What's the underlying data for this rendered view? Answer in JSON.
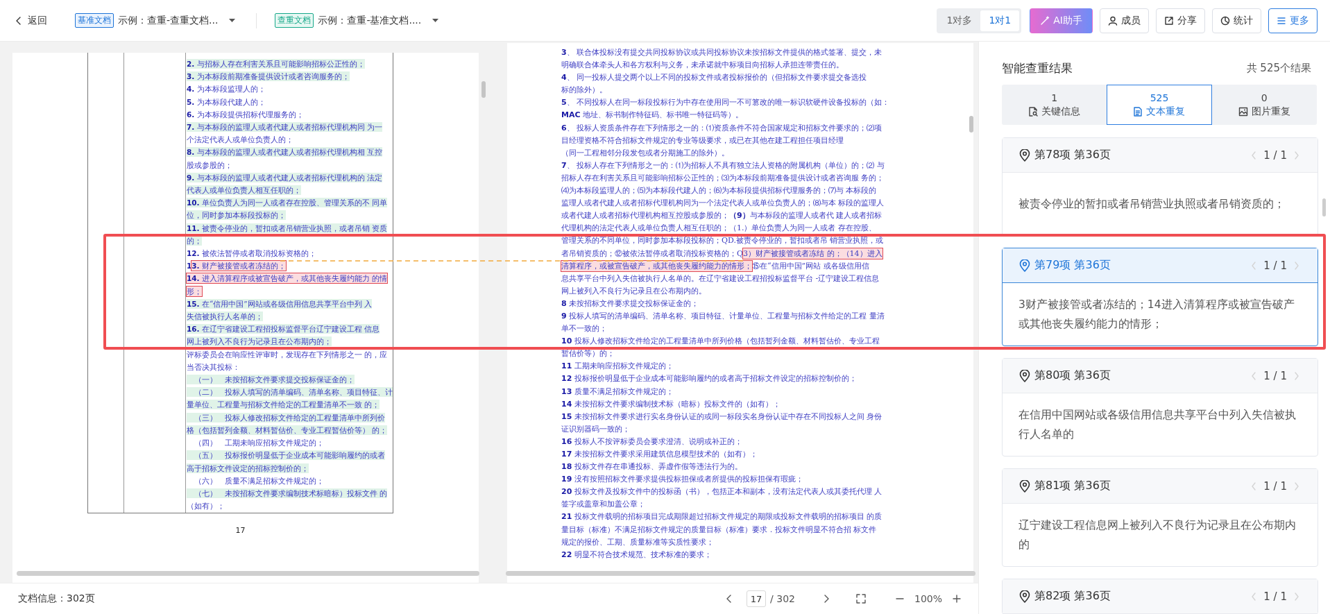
{
  "toolbar": {
    "back": "返回",
    "documents": [
      {
        "kind": "base",
        "tag": "基准文档",
        "name": "示例：查重-查重文档..."
      },
      {
        "kind": "check",
        "tag": "查重文档",
        "name": "示例：查重-基准文档...."
      }
    ],
    "view_modes": [
      {
        "label": "1对多",
        "selected": false
      },
      {
        "label": "1对1",
        "selected": true
      }
    ],
    "actions": [
      {
        "kind": "ai",
        "label": "AI助手"
      },
      {
        "kind": "members",
        "label": "成员"
      },
      {
        "kind": "share",
        "label": "分享"
      },
      {
        "kind": "stats",
        "label": "统计"
      },
      {
        "kind": "more",
        "label": "更多"
      }
    ]
  },
  "left_document": {
    "page_number": "17",
    "lines": [
      [
        {
          "text": "**2.** 与招标人存在利害关系且可能影响招标公正性的；",
          "kind": "similar"
        }
      ],
      [
        {
          "text": "**3.** 为本标段前期准备提供设计或者咨询服务的；",
          "kind": "similar"
        }
      ],
      [
        {
          "text": "**4.** 为本标段监理人的；",
          "kind": "plain"
        }
      ],
      [
        {
          "text": "**5.** 为本标段代建人的；",
          "kind": "plain"
        }
      ],
      [
        {
          "text": "**6.** 为本标段提供招标代理服务的；",
          "kind": "plain"
        }
      ],
      [
        {
          "text": "**7.** 与本标段的监理人或者代建人或者招标代理机构同 为一",
          "kind": "similar"
        }
      ],
      [
        {
          "text": "个法定代表人或单位负责人的；",
          "kind": "plain"
        }
      ],
      [
        {
          "text": "**8.** 与本标段的监理人或者代建人或者招标代理机构相 互控",
          "kind": "similar"
        }
      ],
      [
        {
          "text": "股或参股的；",
          "kind": "plain"
        }
      ],
      [
        {
          "text": "**9.** 与本标段的监理人或者代建人或者招标代理机构的 法定",
          "kind": "similar"
        }
      ],
      [
        {
          "text": "代表人或单位负责人相互任职的；",
          "kind": "similar"
        }
      ],
      [
        {
          "text": "**10.** 单位负责人为同一人或者存在控股、管理关系的不 同单",
          "kind": "similar"
        }
      ],
      [
        {
          "text": "位，同时参加本标段投标的；",
          "kind": "similar"
        }
      ],
      [
        {
          "text": "**11.** 被责令停业的，暂扣或者吊销营业执照，或者吊销 资质",
          "kind": "similar"
        }
      ],
      [
        {
          "text": "的；",
          "kind": "similar"
        }
      ],
      [
        {
          "text": "**12.** 被依法暂停或者取消投标资格的；",
          "kind": "plain"
        }
      ],
      [
        {
          "text": "**1**",
          "kind": "plain"
        },
        {
          "text": "**3.** 财产被接管或者冻结的；",
          "kind": "current"
        }
      ],
      [
        {
          "text": "**14.** 进入清算程序或被宣告破产，或其他丧失履约能力 的情",
          "kind": "current"
        }
      ],
      [
        {
          "text": "形；",
          "kind": "current"
        }
      ],
      [
        {
          "text": "**15.** 在“信用中国”网站或各级信用信息共享平台中列 入",
          "kind": "similar"
        }
      ],
      [
        {
          "text": "失信被执行人名单的；",
          "kind": "similar"
        }
      ],
      [
        {
          "text": "**16.** 在辽宁省建设工程招投标监督平台辽宁建设工程 信息",
          "kind": "similar"
        }
      ],
      [
        {
          "text": "网上被列入不良行为记录且在公布期内的；",
          "kind": "similar"
        }
      ],
      [
        {
          "text": "评标委员会在响应性评审时，发现存在下列情形之一 的，应",
          "kind": "plain"
        }
      ],
      [
        {
          "text": "当否决其投标：",
          "kind": "plain"
        }
      ],
      [
        {
          "text": "　（一）　未按招标文件要求提交投标保证金的；",
          "kind": "similar"
        }
      ],
      [
        {
          "text": "　（二）　投标人填写的清单编码、清单名称、项目特征、计",
          "kind": "similar"
        }
      ],
      [
        {
          "text": "量单位、工程量与招标文件给定的工程量清单不一致 的；",
          "kind": "similar"
        }
      ],
      [
        {
          "text": "　（三）　投标人修改招标文件给定的工程量清单中所列价",
          "kind": "similar"
        }
      ],
      [
        {
          "text": "格（包括暂列金额、材料暂估价、专业工程暂估价等） 的；",
          "kind": "similar"
        }
      ],
      [
        {
          "text": "　（四）　工期未响应招标文件规定的；",
          "kind": "plain"
        }
      ],
      [
        {
          "text": "　（五）　投标报价明显低于企业成本可能影响履约的或者",
          "kind": "similar"
        }
      ],
      [
        {
          "text": "高于招标文件设定的招标控制价的；",
          "kind": "similar"
        }
      ],
      [
        {
          "text": "　（六）　质量不满足招标文件规定的；",
          "kind": "plain"
        }
      ],
      [
        {
          "text": "　（七）　未按招标文件要求编制技术标暗标）投标文件 的",
          "kind": "similar"
        }
      ],
      [
        {
          "text": "（如有）；",
          "kind": "plain"
        }
      ]
    ]
  },
  "right_document": {
    "lines": [
      [
        {
          "text": "**3**、 联合体投标没有提交共同投标协议或共同投标协议未按招标文件提供的格式签署、提交，未",
          "kind": "plain"
        }
      ],
      [
        {
          "text": "明确联合体牵头人和各方权利与义务，未承诺就中标项目向招标人承担连带责任的。",
          "kind": "plain"
        }
      ],
      [
        {
          "text": "**4**、 同一投标人提交两个以上不同的投标文件或者投标报价的（但招标文件要求提交备选投",
          "kind": "plain"
        }
      ],
      [
        {
          "text": "标的除外）。",
          "kind": "plain"
        }
      ],
      [
        {
          "text": "**5**、 不同投标人在同一标段投标行为中存在使用同一不可篡改的唯一标识软硬件设备投标的（如：",
          "kind": "plain"
        }
      ],
      [
        {
          "text": "**MAC** 地址、标书制作特征码、标书唯一特征码等）。",
          "kind": "plain"
        }
      ],
      [
        {
          "text": "**6**、 投标人资质条件存在下列情形之一的：⑴资质条件不符合国家规定和招标文件要求的；⑵项",
          "kind": "plain"
        }
      ],
      [
        {
          "text": "目经理资格不符合招标文件规定的专业等级要求，或已在其他在建工程担任项目经理",
          "kind": "plain"
        }
      ],
      [
        {
          "text": "（同一工程相邻分段发包或者分期施工的除外）。",
          "kind": "plain"
        }
      ],
      [
        {
          "text": "**7**、 投标人存在下列情形之一的：⑴为招标人不具有独立法人资格的附属机构（单位）的；⑵ 与",
          "kind": "plain"
        }
      ],
      [
        {
          "text": "招标人存在利害关系且可能影响招标公正性的；⑶为本标段前期准备提供设计或者咨询服 务的；",
          "kind": "plain"
        }
      ],
      [
        {
          "text": "⑷为本标段监理人的；⑸为本标段代建人的；⑹为本标段提供招标代理服务的；⑺与 本标段的",
          "kind": "plain"
        }
      ],
      [
        {
          "text": "监理人或者代建人或者招标代理机构同为一个法定代表人或单位负责人的；⑻与本 标段的监理人",
          "kind": "plain"
        }
      ],
      [
        {
          "text": "或者代建人或者招标代理机构相互控股或参股的；**（9）**与本标段的监理人或者代 建人或者招标",
          "kind": "plain"
        }
      ],
      [
        {
          "text": "代理机构的法定代表人或单位负责人相互任职的；（1.）单位负责人为同一人或者 存在控股、",
          "kind": "plain"
        }
      ],
      [
        {
          "text": "管理关系的不同单位，同时参加本标段投标的；QD.被责令停业的，暂扣或者吊 销营业执照，或",
          "kind": "plain"
        }
      ],
      [
        {
          "text": "者吊销资质的；⑫被依法暂停或者取消投标资格的；Q",
          "kind": "plain"
        },
        {
          "text": "3）财产被接管或者冻结 的；（14）进入",
          "kind": "current"
        }
      ],
      [
        {
          "text": "清算程序，或被宣告破产，或其他丧失履约能力的情形；",
          "kind": "current"
        },
        {
          "text": "⑮在“信用中国”网站 或各级信用信",
          "kind": "plain"
        }
      ],
      [
        {
          "text": "息共享平台中列入失信被执行人名单的。在辽宁省建设工程招投标监督平台 -辽宁建设工程信息",
          "kind": "plain"
        }
      ],
      [
        {
          "text": "网上被列入不良行为记录且在公布期内的。",
          "kind": "plain"
        }
      ],
      [
        {
          "text": "**8** 未按招标文件要求提交投标保证金的；",
          "kind": "plain"
        }
      ],
      [
        {
          "text": "**9** 投标人填写的清单编码、清单名称、项目特征、计量单位、工程量与招标文件给定的工程 量清",
          "kind": "plain"
        }
      ],
      [
        {
          "text": "单不一致的；",
          "kind": "plain"
        }
      ],
      [
        {
          "text": "**10** 投标人修改招标文件给定的工程量清单中所列价格（包括暂列金额、材料暂估价、专业工程",
          "kind": "plain"
        }
      ],
      [
        {
          "text": "暂估价等）的；",
          "kind": "plain"
        }
      ],
      [
        {
          "text": "**11** 工期未响应招标文件规定的；",
          "kind": "plain"
        }
      ],
      [
        {
          "text": "**12** 投标报价明显低于企业成本可能影响履约的或者高于招标文件设定的招标控制价的；",
          "kind": "plain"
        }
      ],
      [
        {
          "text": "**13** 质量不满足招标文件规定的；",
          "kind": "plain"
        }
      ],
      [
        {
          "text": "**14** 未按招标文件要求编制技术标（暗标）投标文件的（如有）；",
          "kind": "plain"
        }
      ],
      [
        {
          "text": "**15** 未按招标文件要求进行实名身份认证的或同一标段实名身份认证中存在不同投标人之间 身份",
          "kind": "plain"
        }
      ],
      [
        {
          "text": "证识别器码一致的；",
          "kind": "plain"
        }
      ],
      [
        {
          "text": "**16** 投标人不按评标委员会要求澄清、说明或补正的；",
          "kind": "plain"
        }
      ],
      [
        {
          "text": "**17** 未按招标文件要求采用建筑信息模型技术的（如有）；",
          "kind": "plain"
        }
      ],
      [
        {
          "text": "**18** 投标文件存在串通投标、弄虚作假等违法行为的。",
          "kind": "plain"
        }
      ],
      [
        {
          "text": "**19** 没有按照招标文件要求提供投标担保或者所提供的投标担保有瑕疵；",
          "kind": "plain"
        }
      ],
      [
        {
          "text": "**20** 投标文件及投标文件中的投标函（书），包括正本和副本，没有法定代表人或其委托代理 人",
          "kind": "plain"
        }
      ],
      [
        {
          "text": "签字或盖章和加盖公章；",
          "kind": "plain"
        }
      ],
      [
        {
          "text": "**21** 投标文件载明的招标项目完成期限超过招标文件规定的期限或投标文件载明的招标项目 的质",
          "kind": "plain"
        }
      ],
      [
        {
          "text": "量目标（标准）不满足招标文件规定的质量目标（标准）要求．投标文件明显不符合招 标文件",
          "kind": "plain"
        }
      ],
      [
        {
          "text": "规定的报价、工期、质量标准等实质性要求；",
          "kind": "plain"
        }
      ],
      [
        {
          "text": "**22** 明显不符合技术规范、技术标准的要求；",
          "kind": "plain"
        }
      ]
    ]
  },
  "bottom_bar": {
    "doc_info": "文档信息：302页",
    "current_page": "17",
    "total_pages": "/ 302",
    "zoom": "100%"
  },
  "results": {
    "title": "智能查重结果",
    "total": "共 525个结果",
    "tabs": [
      {
        "kind": "key",
        "count": "1",
        "label": "关键信息",
        "selected": false
      },
      {
        "kind": "text",
        "count": "525",
        "label": "文本重复",
        "selected": true
      },
      {
        "kind": "image",
        "count": "0",
        "label": "图片重复",
        "selected": false
      }
    ],
    "cards": [
      {
        "title": "第78项 第36页",
        "pager": "1 / 1",
        "text": "被责令停业的暂扣或者吊销营业执照或者吊销资质的；",
        "selected": false
      },
      {
        "title": "第79项 第36页",
        "pager": "1 / 1",
        "text": "3财产被接管或者冻结的；14进入清算程序或被宣告破产或其他丧失履约能力的情形；",
        "selected": true
      },
      {
        "title": "第80项 第36页",
        "pager": "1 / 1",
        "text": "在信用中国网站或各级信用信息共享平台中列入失信被执行人名单的",
        "selected": false
      },
      {
        "title": "第81项 第36页",
        "pager": "1 / 1",
        "text": "辽宁建设工程信息网上被列入不良行为记录且在公布期内的",
        "selected": false
      },
      {
        "title": "第82项 第36页",
        "pager": "1 / 1",
        "selected": false
      }
    ]
  }
}
